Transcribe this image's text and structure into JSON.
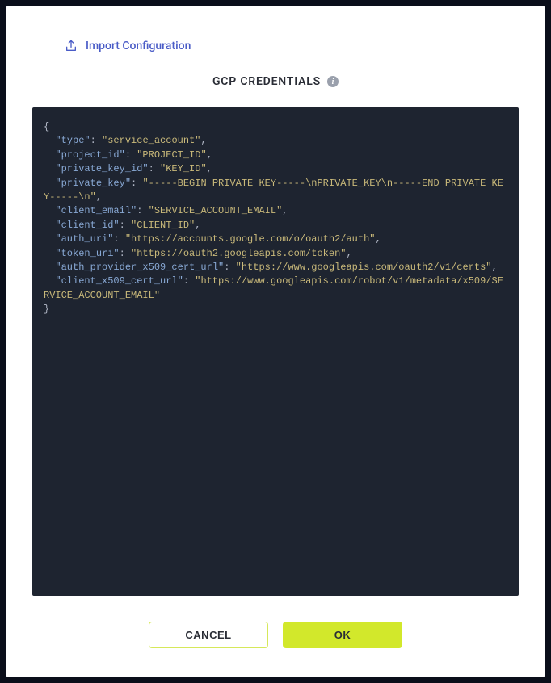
{
  "import_link": "Import Configuration",
  "title": "GCP CREDENTIALS",
  "credentials": {
    "type": "service_account",
    "project_id": "PROJECT_ID",
    "private_key_id": "KEY_ID",
    "private_key": "-----BEGIN PRIVATE KEY-----\\nPRIVATE_KEY\\n-----END PRIVATE KEY-----\\n",
    "client_email": "SERVICE_ACCOUNT_EMAIL",
    "client_id": "CLIENT_ID",
    "auth_uri": "https://accounts.google.com/o/oauth2/auth",
    "token_uri": "https://oauth2.googleapis.com/token",
    "auth_provider_x509_cert_url": "https://www.googleapis.com/oauth2/v1/certs",
    "client_x509_cert_url": "https://www.googleapis.com/robot/v1/metadata/x509/SERVICE_ACCOUNT_EMAIL"
  },
  "buttons": {
    "cancel": "CANCEL",
    "ok": "OK"
  }
}
